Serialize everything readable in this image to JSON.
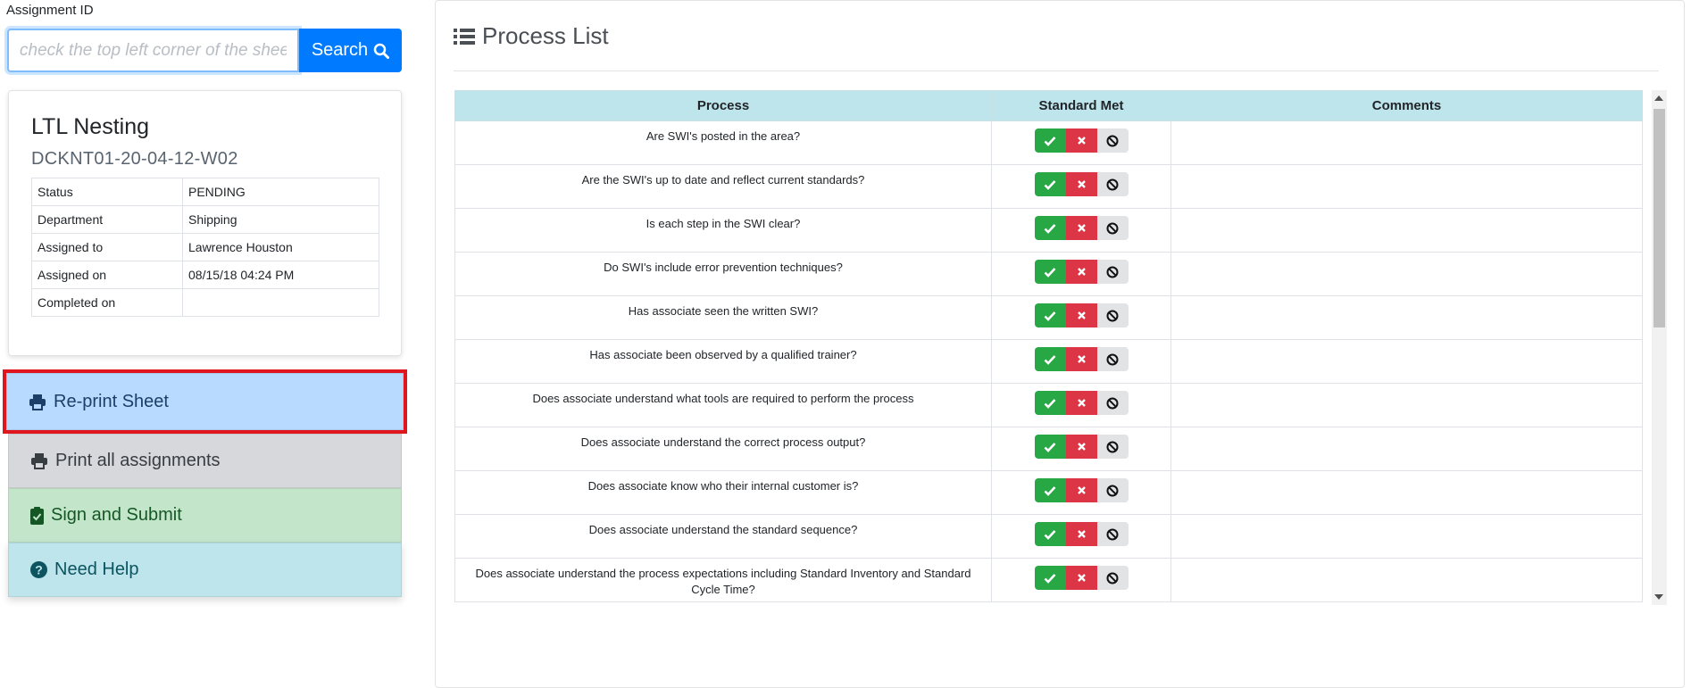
{
  "search": {
    "label": "Assignment ID",
    "placeholder": "check the top left corner of the sheet",
    "button_label": "Search"
  },
  "assignment": {
    "title": "LTL Nesting",
    "code": "DCKNT01-20-04-12-W02",
    "fields": [
      {
        "key": "Status",
        "value": "PENDING"
      },
      {
        "key": "Department",
        "value": "Shipping"
      },
      {
        "key": "Assigned to",
        "value": "Lawrence Houston"
      },
      {
        "key": "Assigned on",
        "value": "08/15/18 04:24 PM"
      },
      {
        "key": "Completed on",
        "value": ""
      }
    ]
  },
  "actions": {
    "reprint": "Re-print Sheet",
    "print_all": "Print all assignments",
    "sign_submit": "Sign and Submit",
    "help": "Need Help"
  },
  "process_list": {
    "title": "Process List",
    "columns": [
      "Process",
      "Standard Met",
      "Comments"
    ],
    "rows": [
      {
        "process": "Are SWI's posted in the area?",
        "comment": ""
      },
      {
        "process": "Are the SWI's up to date and reflect current standards?",
        "comment": ""
      },
      {
        "process": "Is each step in the SWI clear?",
        "comment": ""
      },
      {
        "process": "Do SWI's include error prevention techniques?",
        "comment": ""
      },
      {
        "process": "Has associate seen the written SWI?",
        "comment": ""
      },
      {
        "process": "Has associate been observed by a qualified trainer?",
        "comment": ""
      },
      {
        "process": "Does associate understand what tools are required to perform the process",
        "comment": ""
      },
      {
        "process": "Does associate understand the correct process output?",
        "comment": ""
      },
      {
        "process": "Does associate know who their internal customer is?",
        "comment": ""
      },
      {
        "process": "Does associate understand the standard sequence?",
        "comment": ""
      },
      {
        "process": "Does associate understand the process expectations including Standard Inventory and Standard Cycle Time?",
        "comment": ""
      }
    ]
  },
  "colors": {
    "primary": "#007bff",
    "success": "#28a745",
    "danger": "#dc3545",
    "highlight_border": "#e0161e"
  },
  "icons": {
    "search": "search-icon",
    "list": "list-icon",
    "print": "print-icon",
    "clipboard": "clipboard-check-icon",
    "help": "question-circle-icon",
    "check": "check-icon",
    "times": "times-icon",
    "ban": "ban-icon"
  }
}
